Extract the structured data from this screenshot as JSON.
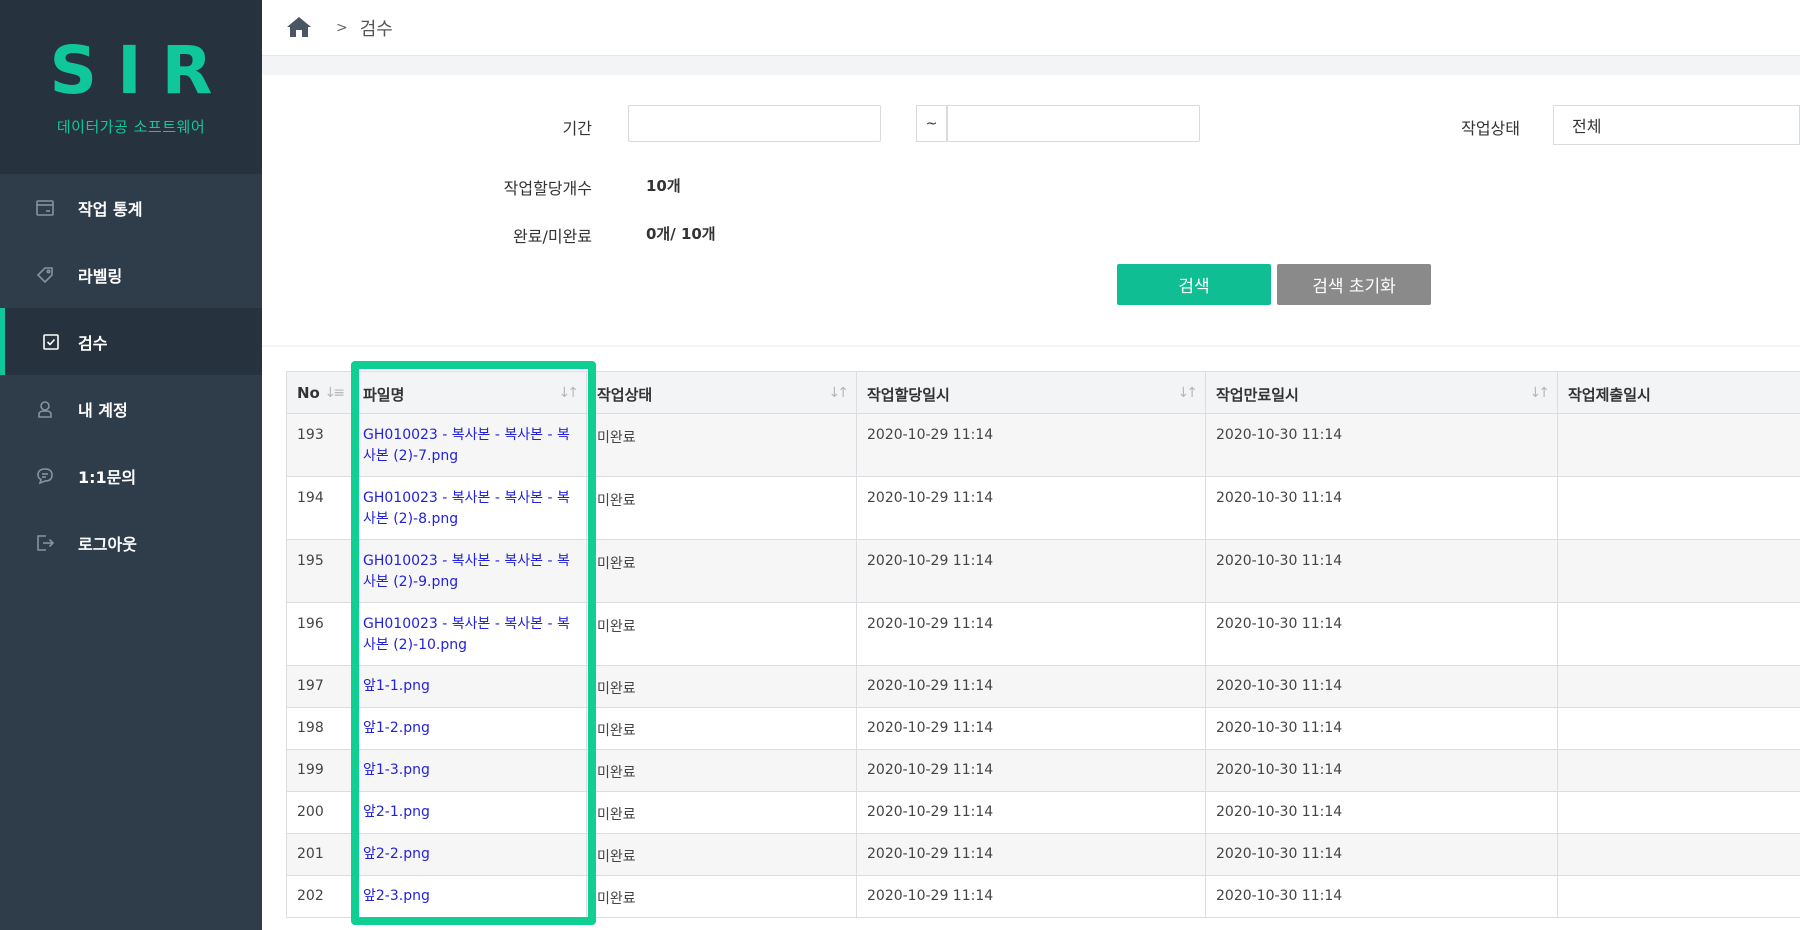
{
  "brand": {
    "title": "SIR",
    "subtitle": "데이터가공 소프트웨어"
  },
  "sidebar": {
    "items": [
      {
        "label": "작업 통계",
        "icon": "calendar-stats-icon"
      },
      {
        "label": "라벨링",
        "icon": "tag-icon"
      },
      {
        "label": "검수",
        "icon": "checkbox-icon"
      },
      {
        "label": "내 계정",
        "icon": "user-icon"
      },
      {
        "label": "1:1문의",
        "icon": "chat-icon"
      },
      {
        "label": "로그아웃",
        "icon": "logout-icon"
      }
    ],
    "active_index": 2
  },
  "breadcrumb": {
    "separator": ">",
    "current": "검수"
  },
  "filter": {
    "period_label": "기간",
    "period_from": "",
    "period_tilde": "~",
    "period_to": "",
    "status_label": "작업상태",
    "status_value": "전체",
    "assigned_label": "작업할당개수",
    "assigned_value": "10개",
    "done_label": "완료/미완료",
    "done_value": "0개/ 10개",
    "search_button": "검색",
    "reset_button": "검색 초기화"
  },
  "table": {
    "columns": [
      "No",
      "파일명",
      "작업상태",
      "작업할당일시",
      "작업만료일시",
      "작업제출일시"
    ],
    "rows": [
      {
        "no": "193",
        "file": "GH010023 - 복사본 - 복사본 - 복사본 (2)-7.png",
        "status": "미완료",
        "assigned": "2020-10-29 11:14",
        "expires": "2020-10-30 11:14",
        "submitted": ""
      },
      {
        "no": "194",
        "file": "GH010023 - 복사본 - 복사본 - 복사본 (2)-8.png",
        "status": "미완료",
        "assigned": "2020-10-29 11:14",
        "expires": "2020-10-30 11:14",
        "submitted": ""
      },
      {
        "no": "195",
        "file": "GH010023 - 복사본 - 복사본 - 복사본 (2)-9.png",
        "status": "미완료",
        "assigned": "2020-10-29 11:14",
        "expires": "2020-10-30 11:14",
        "submitted": ""
      },
      {
        "no": "196",
        "file": "GH010023 - 복사본 - 복사본 - 복사본 (2)-10.png",
        "status": "미완료",
        "assigned": "2020-10-29 11:14",
        "expires": "2020-10-30 11:14",
        "submitted": ""
      },
      {
        "no": "197",
        "file": "앞1-1.png",
        "status": "미완료",
        "assigned": "2020-10-29 11:14",
        "expires": "2020-10-30 11:14",
        "submitted": ""
      },
      {
        "no": "198",
        "file": "앞1-2.png",
        "status": "미완료",
        "assigned": "2020-10-29 11:14",
        "expires": "2020-10-30 11:14",
        "submitted": ""
      },
      {
        "no": "199",
        "file": "앞1-3.png",
        "status": "미완료",
        "assigned": "2020-10-29 11:14",
        "expires": "2020-10-30 11:14",
        "submitted": ""
      },
      {
        "no": "200",
        "file": "앞2-1.png",
        "status": "미완료",
        "assigned": "2020-10-29 11:14",
        "expires": "2020-10-30 11:14",
        "submitted": ""
      },
      {
        "no": "201",
        "file": "앞2-2.png",
        "status": "미완료",
        "assigned": "2020-10-29 11:14",
        "expires": "2020-10-30 11:14",
        "submitted": ""
      },
      {
        "no": "202",
        "file": "앞2-3.png",
        "status": "미완료",
        "assigned": "2020-10-29 11:14",
        "expires": "2020-10-30 11:14",
        "submitted": ""
      }
    ]
  },
  "colors": {
    "accent": "#10c79c",
    "sidebar": "#2f3d4b",
    "highlight": "#0fcf92",
    "link": "#2222dd"
  }
}
